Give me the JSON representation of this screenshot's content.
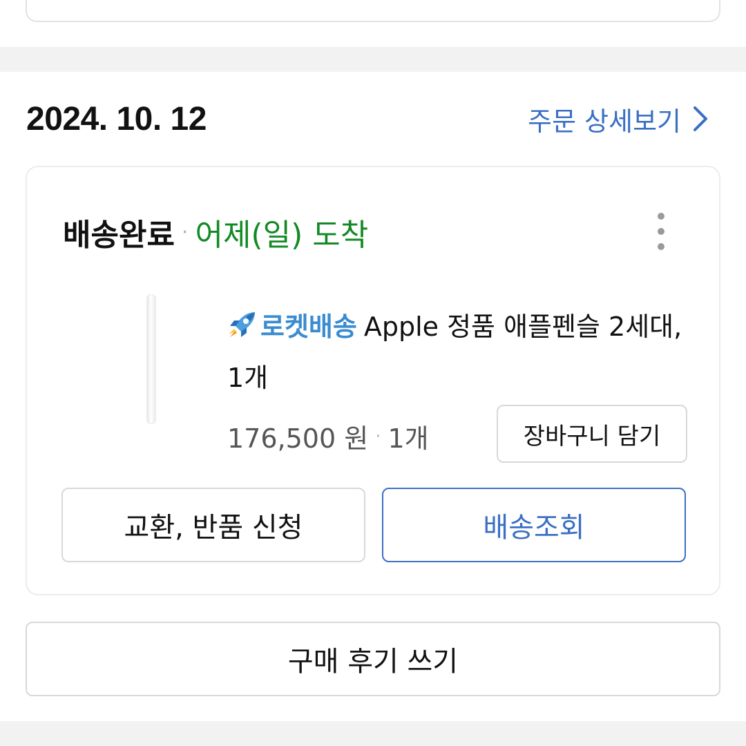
{
  "order": {
    "date": "2024. 10. 12",
    "detail_link": "주문 상세보기",
    "status": "배송완료",
    "separator": "·",
    "arrival": "어제(일) 도착"
  },
  "product": {
    "badge_label": "로켓배송",
    "name": "Apple 정품 애플펜슬 2세대, 1개",
    "price": "176,500 원",
    "quantity": "1개"
  },
  "buttons": {
    "add_to_cart": "장바구니 담기",
    "exchange_return": "교환, 반품 신청",
    "track_delivery": "배송조회",
    "write_review": "구매 후기 쓰기"
  },
  "colors": {
    "link_blue": "#3a6fc4",
    "arrival_green": "#128a24",
    "rocket_blue": "#3a8bd0"
  },
  "icons": {
    "detail_arrow": "chevron-right-icon",
    "menu": "more-vertical-icon",
    "badge": "rocket-icon"
  }
}
